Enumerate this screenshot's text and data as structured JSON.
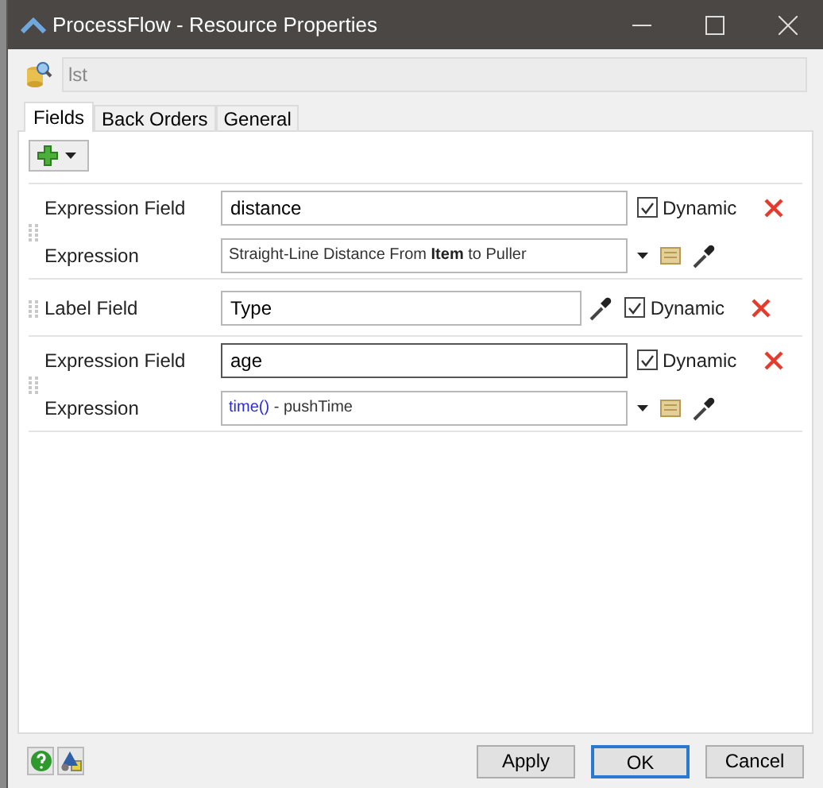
{
  "window": {
    "title": "ProcessFlow - Resource Properties"
  },
  "name_field": {
    "value": "lst"
  },
  "tabs": [
    {
      "label": "Fields",
      "selected": true
    },
    {
      "label": "Back Orders",
      "selected": false
    },
    {
      "label": "General",
      "selected": false
    }
  ],
  "rows": [
    {
      "kind": "expression",
      "field_label": "Expression Field",
      "field_value": "distance",
      "focused": false,
      "dynamic": true,
      "dynamic_label": "Dynamic",
      "expression_label": "Expression",
      "expression": [
        {
          "text": "Straight-Line Distance From ",
          "kind": "plain"
        },
        {
          "text": "Item",
          "kind": "bold"
        },
        {
          "text": " to Puller",
          "kind": "plain"
        }
      ]
    },
    {
      "kind": "label",
      "field_label": "Label Field",
      "field_value": "Type",
      "focused": false,
      "dynamic": true,
      "dynamic_label": "Dynamic"
    },
    {
      "kind": "expression",
      "field_label": "Expression Field",
      "field_value": "age",
      "focused": true,
      "dynamic": true,
      "dynamic_label": "Dynamic",
      "expression_label": "Expression",
      "expression": [
        {
          "text": "time()",
          "kind": "keyword"
        },
        {
          "text": " - pushTime",
          "kind": "plain"
        }
      ]
    }
  ],
  "buttons": [
    {
      "label": "Apply",
      "default": false
    },
    {
      "label": "OK",
      "default": true
    },
    {
      "label": "Cancel",
      "default": false
    }
  ]
}
